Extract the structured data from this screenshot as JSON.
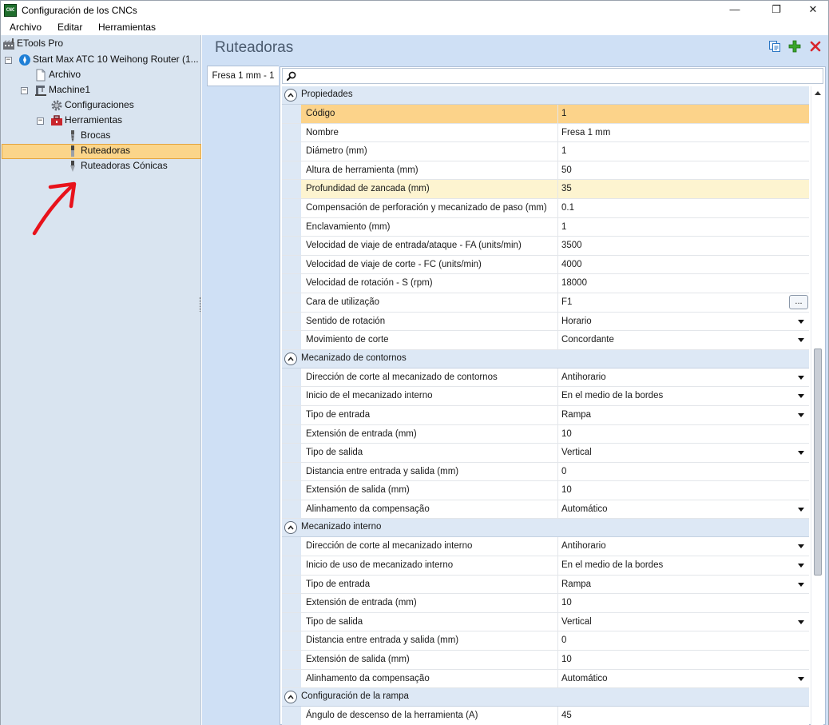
{
  "window": {
    "title": "Configuración de los CNCs",
    "app_icon_text": "CNC",
    "minimize_glyph": "—",
    "maximize_glyph": "❐",
    "close_glyph": "✕"
  },
  "menu": [
    "Archivo",
    "Editar",
    "Herramientas"
  ],
  "tree": {
    "root": "ETools Pro",
    "machine": "Start Max ATC 10 Weihong Router (1...",
    "archivo": "Archivo",
    "machine1": "Machine1",
    "configuraciones": "Configuraciones",
    "herramientas": "Herramientas",
    "brocas": "Brocas",
    "ruteadoras": "Ruteadoras",
    "ruteadoras_conicas": "Ruteadoras Cónicas"
  },
  "main": {
    "title": "Ruteadoras",
    "tab_label": "Fresa 1 mm - 1"
  },
  "grid": {
    "categories": [
      {
        "label": "Propiedades",
        "rows": [
          {
            "name": "Código",
            "value": "1",
            "state": "selected"
          },
          {
            "name": "Nombre",
            "value": "Fresa 1 mm"
          },
          {
            "name": "Diámetro (mm)",
            "value": "1"
          },
          {
            "name": "Altura de herramienta (mm)",
            "value": "50"
          },
          {
            "name": "Profundidad de zancada (mm)",
            "value": "35",
            "state": "highlight"
          },
          {
            "name": "Compensación de perforación y mecanizado de paso (mm)",
            "value": "0.1"
          },
          {
            "name": "Enclavamiento (mm)",
            "value": "1"
          },
          {
            "name": "Velocidad de viaje de entrada/ataque - FA (units/min)",
            "value": "3500"
          },
          {
            "name": "Velocidad de viaje de corte - FC (units/min)",
            "value": "4000"
          },
          {
            "name": "Velocidad de rotación - S (rpm)",
            "value": "18000"
          },
          {
            "name": "Cara de utilização",
            "value": "F1",
            "editor": "ellipsis"
          },
          {
            "name": "Sentido de rotación",
            "value": "Horario",
            "editor": "dropdown"
          },
          {
            "name": "Movimiento de corte",
            "value": "Concordante",
            "editor": "dropdown"
          }
        ]
      },
      {
        "label": "Mecanizado de contornos",
        "rows": [
          {
            "name": "Dirección de corte al mecanizado de contornos",
            "value": "Antihorario",
            "editor": "dropdown"
          },
          {
            "name": "Inicio de el mecanizado interno",
            "value": "En el medio de la bordes",
            "editor": "dropdown"
          },
          {
            "name": "Tipo de entrada",
            "value": "Rampa",
            "editor": "dropdown"
          },
          {
            "name": "Extensión de entrada (mm)",
            "value": "10"
          },
          {
            "name": "Tipo de salida",
            "value": "Vertical",
            "editor": "dropdown"
          },
          {
            "name": "Distancia entre entrada y salida (mm)",
            "value": "0"
          },
          {
            "name": "Extensión de salida (mm)",
            "value": "10"
          },
          {
            "name": "Alinhamento da compensação",
            "value": "Automático",
            "editor": "dropdown"
          }
        ]
      },
      {
        "label": "Mecanizado interno",
        "rows": [
          {
            "name": "Dirección de corte al mecanizado interno",
            "value": "Antihorario",
            "editor": "dropdown"
          },
          {
            "name": "Inicio de uso de mecanizado interno",
            "value": "En el medio de la bordes",
            "editor": "dropdown"
          },
          {
            "name": "Tipo de entrada",
            "value": "Rampa",
            "editor": "dropdown"
          },
          {
            "name": "Extensión de entrada (mm)",
            "value": "10"
          },
          {
            "name": "Tipo de salida",
            "value": "Vertical",
            "editor": "dropdown"
          },
          {
            "name": "Distancia entre entrada y salida (mm)",
            "value": "0"
          },
          {
            "name": "Extensión de salida (mm)",
            "value": "10"
          },
          {
            "name": "Alinhamento da compensação",
            "value": "Automático",
            "editor": "dropdown"
          }
        ]
      },
      {
        "label": "Configuración de la rampa",
        "rows": [
          {
            "name": "Ángulo de descenso de la herramienta (A)",
            "value": "45"
          }
        ]
      }
    ],
    "ellipsis_label": "...",
    "scroll_position": 0.62
  },
  "colors": {
    "selection": "#fcd38a",
    "highlight": "#fdf4d0",
    "annotation": "#e8121b",
    "add": "#3aa52b",
    "delete": "#d9252c"
  }
}
